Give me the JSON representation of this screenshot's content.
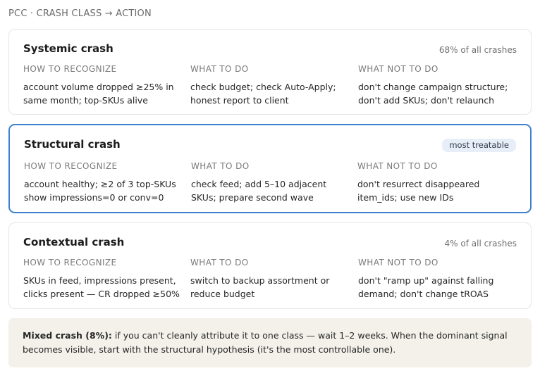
{
  "header": {
    "title": "PCC · CRASH CLASS → ACTION"
  },
  "columns": {
    "recognize": "HOW TO RECOGNIZE",
    "do": "WHAT TO DO",
    "not": "WHAT NOT TO DO"
  },
  "cards": [
    {
      "title": "Systemic crash",
      "meta": "68% of all crashes",
      "recognize": "account volume dropped ≥25% in same month; top-SKUs alive",
      "do": "check budget; check Auto-Apply; honest report to client",
      "not": "don't change campaign structure; don't add SKUs; don't relaunch"
    },
    {
      "title": "Structural crash",
      "badge": "most treatable",
      "recognize": "account healthy; ≥2 of 3 top-SKUs show impressions=0 or conv=0",
      "do": "check feed; add 5–10 adjacent SKUs; prepare second wave",
      "not": "don't resurrect disappeared item_ids; use new IDs"
    },
    {
      "title": "Contextual crash",
      "meta": "4% of all crashes",
      "recognize": "SKUs in feed, impressions present, clicks present — CR dropped ≥50%",
      "do": "switch to backup assortment or reduce budget",
      "not": "don't \"ramp up\" against falling demand; don't change tROAS"
    }
  ],
  "note": {
    "label": "Mixed crash (8%):",
    "text": " if you can't cleanly attribute it to one class — wait 1–2 weeks. When the dominant signal becomes visible, start with the structural hypothesis (it's the most controllable one)."
  },
  "colors": {
    "highlight_border": "#3d82cf",
    "badge_bg": "#e7eef7",
    "note_bg": "#f3f1ea"
  }
}
